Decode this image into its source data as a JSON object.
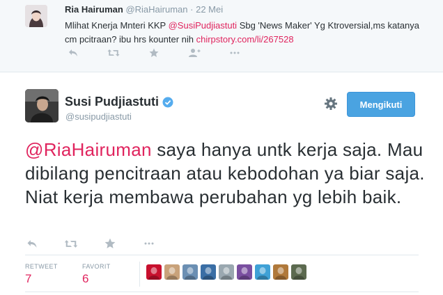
{
  "reply_tweet": {
    "name": "Ria Hairuman",
    "handle": "@RiaHairuman",
    "separator": "·",
    "time": "22 Mei",
    "text_before": "Mlihat Knerja Mnteri KKP ",
    "mention": "@SusiPudjiastuti",
    "text_after": " Sbg 'News Maker' Yg Ktroversial,ms katanya cm pcitraan? ibu hrs kounter nih ",
    "link": "chirpstory.com/li/267528"
  },
  "main_tweet": {
    "name": "Susi Pudjiastuti",
    "handle": "@susipudjiastuti",
    "follow_label": "Mengikuti",
    "mention": "@RiaHairuman",
    "text": " saya hanya untk kerja saja. Mau dibilang pencitraan atau kebodohan ya biar saja. Niat kerja membawa perubahan yg lebih baik."
  },
  "stats": {
    "retweet_label": "RETWEET",
    "retweet_count": "7",
    "favorite_label": "FAVORIT",
    "favorite_count": "6"
  },
  "icons": {
    "reply": "reply-icon",
    "retweet": "retweet-icon",
    "favorite": "star-icon",
    "follow": "follow-icon",
    "more": "more-icon",
    "settings": "gear-icon",
    "verified": "verified-badge-icon"
  },
  "colors": {
    "accent": "#e0245e",
    "follow_button": "#4aa3e1",
    "muted": "#8899a6",
    "verified": "#55acee"
  },
  "likers": [
    {
      "color": "#c8102e"
    },
    {
      "color": "#c9a27a"
    },
    {
      "color": "#6b8fb3"
    },
    {
      "color": "#3a6ea5"
    },
    {
      "color": "#9aa8b0"
    },
    {
      "color": "#7a4fa0"
    },
    {
      "color": "#3fa1d6"
    },
    {
      "color": "#b0793b"
    },
    {
      "color": "#5c6a4f"
    }
  ]
}
